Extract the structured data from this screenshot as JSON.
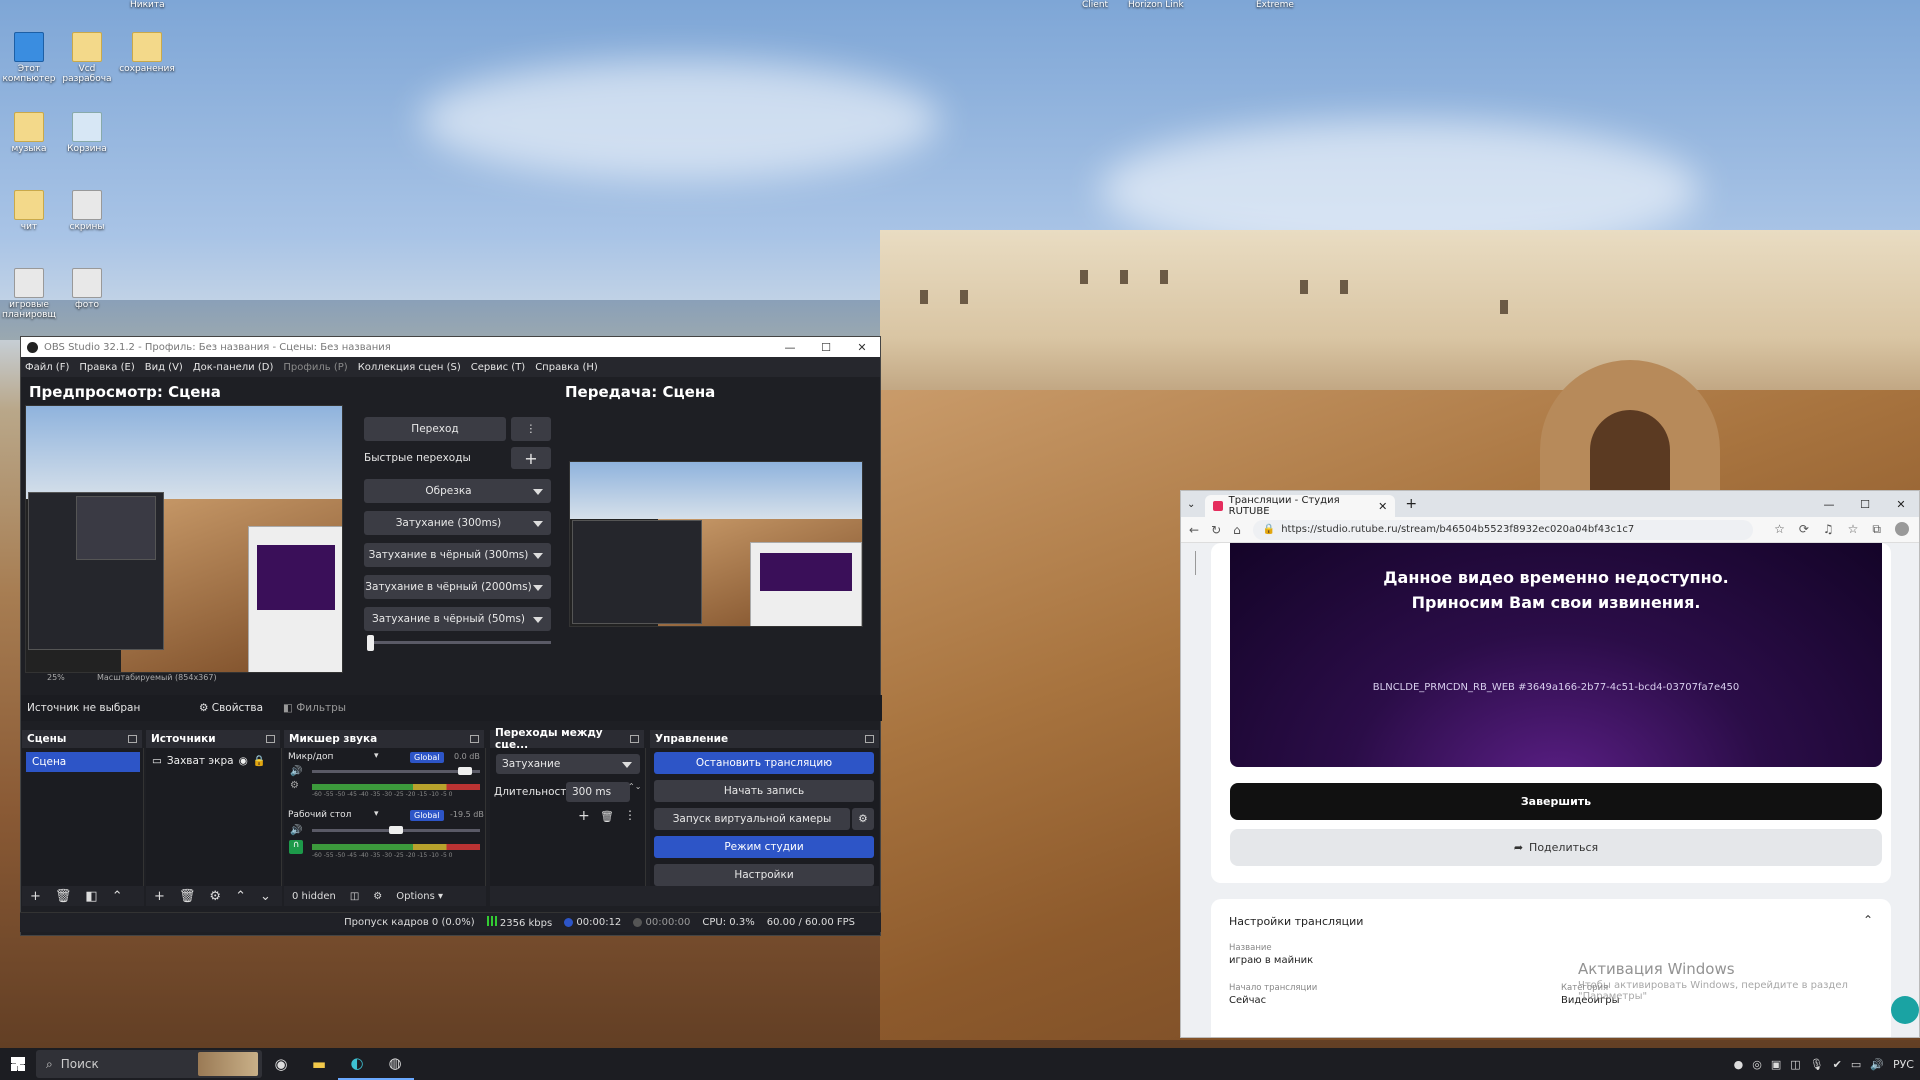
{
  "desktop": {
    "icons": [
      {
        "label": "Этот компьютер",
        "kind": "pc"
      },
      {
        "label": "Vcd разрабоча",
        "kind": "folder"
      },
      {
        "label": "сохранения",
        "kind": "folder"
      },
      {
        "label": "музыка",
        "kind": "folder"
      },
      {
        "label": "Корзина",
        "kind": "bin"
      },
      {
        "label": "чит",
        "kind": "folder"
      },
      {
        "label": "скрины",
        "kind": "exe"
      },
      {
        "label": "игровые планировщ",
        "kind": "exe"
      },
      {
        "label": "фото",
        "kind": "exe"
      }
    ],
    "top_labels": [
      "Никита",
      "Client",
      "Horizon Link",
      "Extreme"
    ]
  },
  "obs": {
    "title": "OBS Studio 32.1.2 - Профиль: Без названия - Сцены: Без названия",
    "window_controls": [
      "—",
      "☐",
      "✕"
    ],
    "menu": [
      "Файл (F)",
      "Правка (E)",
      "Вид (V)",
      "Док-панели (D)",
      "Профиль (P)",
      "Коллекция сцен (S)",
      "Сервис (T)",
      "Справка (H)"
    ],
    "preview_title": "Предпросмотр: Сцена",
    "program_title": "Передача: Сцена",
    "preview_zoom": "25%",
    "preview_scale": "Масштабируемый (854x367)",
    "transition_button": "Переход",
    "quick_transitions_label": "Быстрые переходы",
    "quick_transitions": [
      "Обрезка",
      "Затухание (300ms)",
      "Затухание в чёрный (300ms)",
      "Затухание в чёрный (2000ms)",
      "Затухание в чёрный (50ms)"
    ],
    "source_bar": {
      "no_source": "Источник не выбран",
      "properties": "Свойства",
      "filters": "Фильтры"
    },
    "docks": {
      "scenes": {
        "title": "Сцены",
        "items": [
          "Сцена"
        ]
      },
      "sources": {
        "title": "Источники",
        "items": [
          "Захват экра"
        ]
      },
      "mixer": {
        "title": "Микшер звука",
        "channels": [
          {
            "name": "Микр/доп",
            "badge": "Global",
            "db": "0.0 dB",
            "level": 0.95
          },
          {
            "name": "Рабочий стол",
            "badge": "Global",
            "db": "-19.5 dB",
            "level": 0.5
          }
        ],
        "scale": "-60 -55 -50 -45 -40 -35 -30 -25 -20 -15 -10 -5 0",
        "hidden": "0 hidden",
        "options": "Options"
      },
      "transitions": {
        "title": "Переходы между сце...",
        "selected": "Затухание",
        "duration_label": "Длительность",
        "duration_value": "300 ms"
      },
      "controls": {
        "title": "Управление",
        "stop_stream": "Остановить трансляцию",
        "start_record": "Начать запись",
        "virtual_cam": "Запуск виртуальной камеры",
        "studio_mode": "Режим студии",
        "settings": "Настройки"
      }
    },
    "status": {
      "dropped": "Пропуск кадров 0 (0.0%)",
      "bitrate": "2356 kbps",
      "stream_time": "00:00:12",
      "rec_time": "00:00:00",
      "cpu": "CPU: 0.3%",
      "fps": "60.00 / 60.00 FPS"
    }
  },
  "browser": {
    "tab_title": "Трансляции - Студия RUTUBE",
    "url": "https://studio.rutube.ru/stream/b46504b5523f8932ec020a04bf43c1c7",
    "video_message_line1": "Данное видео временно недоступно.",
    "video_message_line2": "Приносим Вам свои извинения.",
    "error_code": "BLNCLDE_PRMCDN_RB_WEB #3649a166-2b77-4c51-bcd4-03707fa7e450",
    "finish_button": "Завершить",
    "share_button": "Поделиться",
    "settings_title": "Настройки трансляции",
    "fields": {
      "name_label": "Название",
      "name_value": "играю в майник",
      "start_label": "Начало трансляции",
      "start_value": "Сейчас",
      "category_label": "Категория",
      "category_value": "Видеоигры"
    }
  },
  "watermark": {
    "line1": "Активация Windows",
    "line2": "Чтобы активировать Windows, перейдите в раздел \"Параметры\""
  },
  "taskbar": {
    "search": "Поиск",
    "lang": "РУС"
  }
}
